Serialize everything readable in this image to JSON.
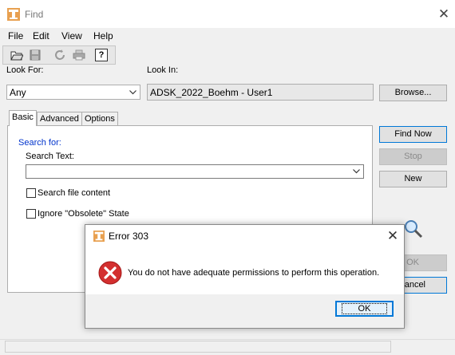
{
  "window": {
    "title": "Find",
    "close_glyph": "✕"
  },
  "menu": {
    "items": [
      "File",
      "Edit",
      "View",
      "Help"
    ]
  },
  "toolbar": {
    "icons": [
      "open-folder-icon",
      "save-icon",
      "refresh-icon",
      "print-icon",
      "help-icon"
    ]
  },
  "look_for": {
    "label": "Look For:",
    "value": "Any"
  },
  "look_in": {
    "label": "Look In:",
    "value": "ADSK_2022_Boehm - User1"
  },
  "buttons": {
    "browse": "Browse...",
    "find_now": "Find Now",
    "stop": "Stop",
    "new": "New",
    "ok_partial": "OK",
    "cancel_partial": "ancel"
  },
  "tabs": [
    "Basic",
    "Advanced",
    "Options"
  ],
  "basic": {
    "search_for": "Search for:",
    "search_text_label": "Search Text:",
    "search_text_value": "",
    "search_file_content": "Search file content",
    "ignore_obsolete": "Ignore \"Obsolete\" State"
  },
  "dialog": {
    "title": "Error 303",
    "message": "You do not have adequate permissions to perform this operation.",
    "ok_label": "OK",
    "close_glyph": "✕"
  },
  "colors": {
    "accent": "#0078d7",
    "error_red": "#d32f2f",
    "window_bg": "#f0f0f0",
    "link_blue": "#0033cc"
  }
}
